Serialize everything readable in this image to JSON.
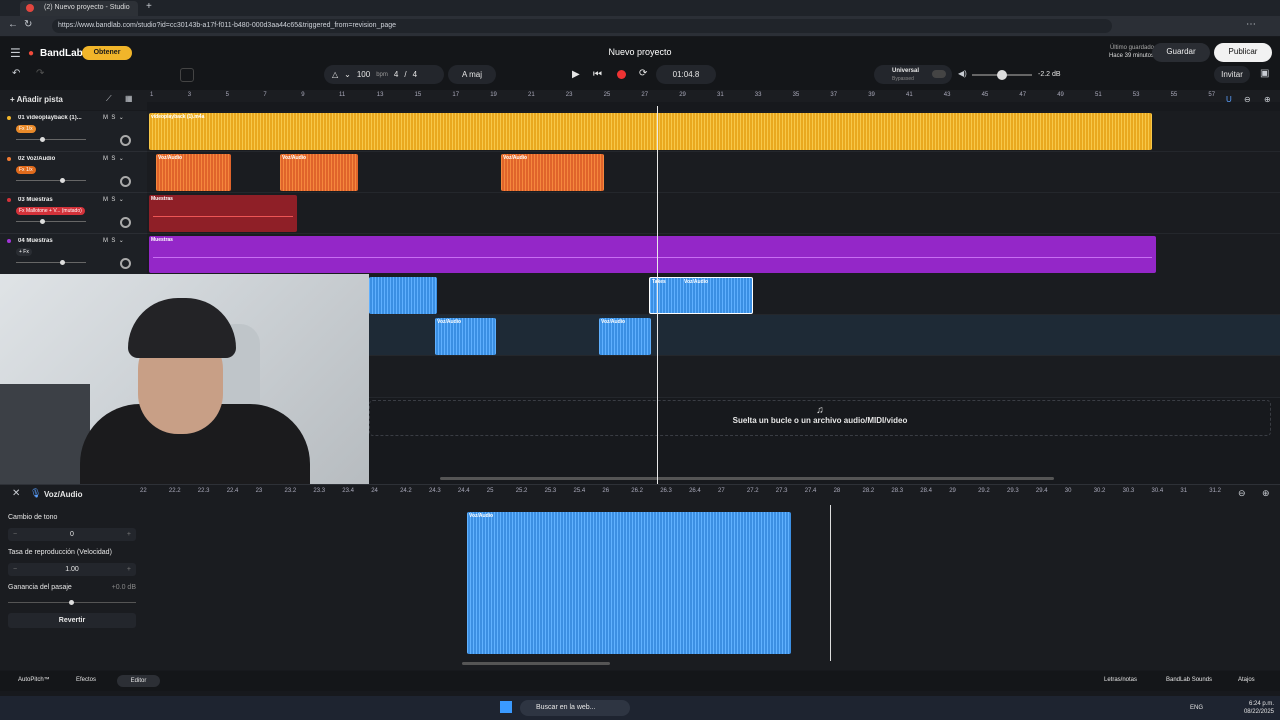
{
  "browser": {
    "tab_title": "(2) Nuevo proyecto - Studio",
    "url": "https://www.bandlab.com/studio?id=cc30143b-a17f-f011-b480-000d3aa44c65&triggered_from=revision_page"
  },
  "header": {
    "logo": "BandLab",
    "obtain": "Obtener",
    "project_title": "Nuevo proyecto",
    "last_saved_label": "Último guardado",
    "last_saved_value": "Hace 39 minutos",
    "save": "Guardar",
    "publish": "Publicar",
    "invite": "Invitar"
  },
  "transport": {
    "bpm": "100",
    "bpm_unit": "bpm",
    "time_sig_num": "4",
    "time_sig_sep": "/",
    "time_sig_den": "4",
    "key": "A maj",
    "time": "01:04.8",
    "universal": "Universal",
    "bypassed": "Bypassed",
    "volume_db": "-2.2 dB"
  },
  "add_track": "Añadir pista",
  "ruler": [
    "1",
    "3",
    "5",
    "7",
    "9",
    "11",
    "13",
    "15",
    "17",
    "19",
    "21",
    "23",
    "25",
    "27",
    "29",
    "31",
    "33",
    "35",
    "37",
    "39",
    "41",
    "43",
    "45",
    "47",
    "49",
    "51",
    "53",
    "55",
    "57"
  ],
  "tracks": [
    {
      "num": "01",
      "name": "videoplayback (1)...",
      "fx": "Fx 1/x",
      "clip_label": "videoplayback (1).m4a"
    },
    {
      "num": "02",
      "name": "Voz/Audio",
      "fx": "Fx 1/x",
      "clip_label": "Voz/Audio"
    },
    {
      "num": "03",
      "name": "Muestras",
      "fx": "Fx Mallotone + V... (mutado)",
      "clip_label": "Muestras"
    },
    {
      "num": "04",
      "name": "Muestras",
      "fx": "+ Fx",
      "clip_label": "Muestras"
    }
  ],
  "ms": {
    "m": "M",
    "s": "S"
  },
  "takes_label": "Takes",
  "clip_voz": "Voz/Audio",
  "drop_zone": "Suelta un bucle o un archivo audio/MIDI/video",
  "editor": {
    "title": "Voz/Audio",
    "pitch_label": "Cambio de tono",
    "pitch_value": "0",
    "rate_label": "Tasa de reproducción (Velocidad)",
    "rate_value": "1.00",
    "gain_label": "Ganancia del pasaje",
    "gain_value": "+0.0 dB",
    "revert": "Revertir",
    "ruler": [
      "22",
      "22.2",
      "22.3",
      "22.4",
      "23",
      "23.2",
      "23.3",
      "23.4",
      "24",
      "24.2",
      "24.3",
      "24.4",
      "25",
      "25.2",
      "25.3",
      "25.4",
      "26",
      "26.2",
      "26.3",
      "26.4",
      "27",
      "27.2",
      "27.3",
      "27.4",
      "28",
      "28.2",
      "28.3",
      "28.4",
      "29",
      "29.2",
      "29.3",
      "29.4",
      "30",
      "30.2",
      "30.3",
      "30.4",
      "31",
      "31.2"
    ]
  },
  "footer": {
    "autopitch": "AutoPitch™",
    "effects": "Efectos",
    "editor": "Editor",
    "lyrics": "Letras/notas",
    "sounds": "BandLab Sounds",
    "shortcuts": "Atajos"
  },
  "taskbar": {
    "search": "Buscar en la web...",
    "lang": "ENG",
    "time": "6:24 p.m.",
    "date": "08/22/2025"
  }
}
